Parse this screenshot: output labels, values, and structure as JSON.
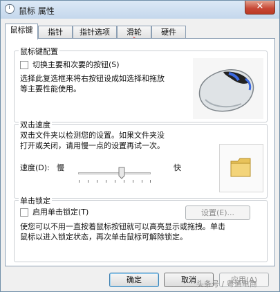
{
  "window": {
    "title": "鼠标 属性",
    "close_glyph": "✕"
  },
  "tabs": [
    "鼠标键",
    "指针",
    "指针选项",
    "滑轮",
    "硬件"
  ],
  "active_tab": 0,
  "button_config": {
    "legend": "鼠标键配置",
    "checkbox_label": "切换主要和次要的按钮(S)",
    "checked": false,
    "description_line1": "选择此复选框来将右按钮设成如选择和拖放",
    "description_line2": "等主要性能使用。"
  },
  "double_click": {
    "legend": "双击速度",
    "description_line1": "双击文件夹以检测您的设置。如果文件夹没",
    "description_line2": "打开或关闭，请用慢一点的设置再试一次。",
    "speed_label": "速度(D):",
    "slow_label": "慢",
    "fast_label": "快",
    "speed_value_fraction": 0.6
  },
  "click_lock": {
    "legend": "单击锁定",
    "checkbox_label": "启用单击锁定(T)",
    "checked": false,
    "settings_button": "设置(E)...",
    "description_line1": "使您可以不用一直按着鼠标按钮就可以高亮显示或拖拽。单击",
    "description_line2": "鼠标以进入锁定状态，再次单击鼠标可解除锁定。"
  },
  "footer": {
    "ok": "确定",
    "cancel": "取消",
    "apply": "应用(A)"
  },
  "watermark": "头条号 / 粤通电商",
  "colors": {
    "annotation_arrow": "#e53935",
    "close_button": "#c74634"
  }
}
